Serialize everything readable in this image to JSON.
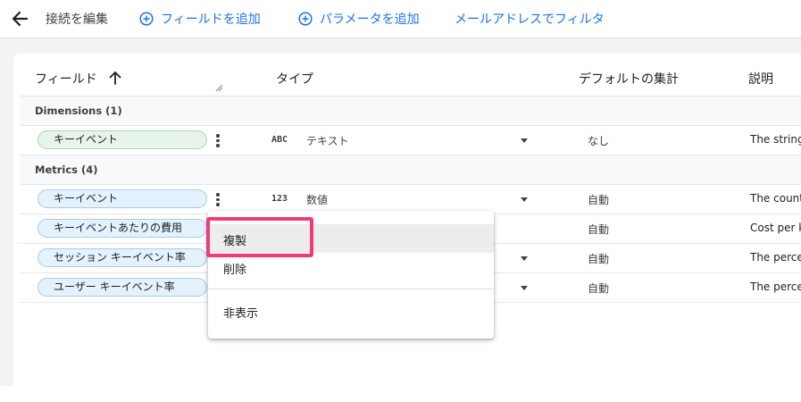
{
  "toolbar": {
    "title": "接続を編集",
    "add_field": "フィールドを追加",
    "add_parameter": "パラメータを追加",
    "filter_by_email": "メールアドレスでフィルタ"
  },
  "table": {
    "headers": {
      "field": "フィールド",
      "type": "タイプ",
      "default_aggregation": "デフォルトの集計",
      "description": "説明"
    },
    "dimensions_section": "Dimensions (1)",
    "metrics_section": "Metrics (4)",
    "dimensions": [
      {
        "name": "キーイベント",
        "type_badge": "ABC",
        "type": "テキスト",
        "aggregation": "なし",
        "description": "The string"
      }
    ],
    "metrics": [
      {
        "name": "キーイベント",
        "type_badge": "123",
        "type": "数値",
        "aggregation": "自動",
        "description": "The count"
      },
      {
        "name": "キーイベントあたりの費用",
        "aggregation": "自動",
        "description": "Cost per ke"
      },
      {
        "name": "セッション キーイベント率",
        "aggregation": "自動",
        "description": "The percer"
      },
      {
        "name": "ユーザー キーイベント率",
        "aggregation": "自動",
        "description": "The percen"
      }
    ]
  },
  "context_menu": {
    "duplicate": "複製",
    "delete": "削除",
    "hide": "非表示"
  },
  "colors": {
    "accent": "#1a73e8",
    "dimension_chip": "#e6f4ea",
    "metric_chip": "#e3f2fd",
    "highlight": "#f23a77"
  }
}
